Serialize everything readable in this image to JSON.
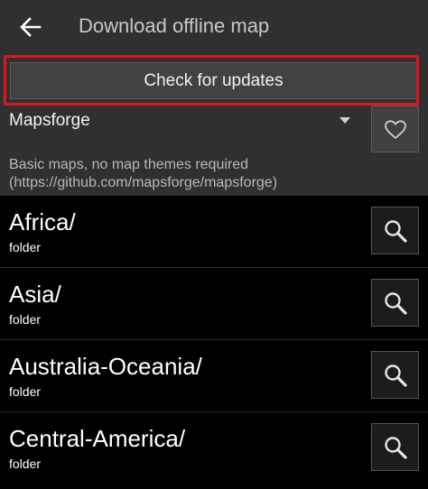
{
  "header": {
    "title": "Download offline map"
  },
  "toolbar": {
    "check_updates_label": "Check for updates"
  },
  "source": {
    "selected": "Mapsforge",
    "description_line1": "Basic maps, no map themes required",
    "description_line2": "(https://github.com/mapsforge/mapsforge)"
  },
  "folders": [
    {
      "name": "Africa/",
      "type": "folder"
    },
    {
      "name": "Asia/",
      "type": "folder"
    },
    {
      "name": "Australia-Oceania/",
      "type": "folder"
    },
    {
      "name": "Central-America/",
      "type": "folder"
    }
  ],
  "colors": {
    "highlight": "#e0141e",
    "header_bg": "#303030",
    "list_bg": "#000000"
  },
  "icons": {
    "back": "arrow-back-icon",
    "dropdown": "chevron-down-icon",
    "favorite": "heart-outline-icon",
    "search": "magnifier-icon"
  }
}
